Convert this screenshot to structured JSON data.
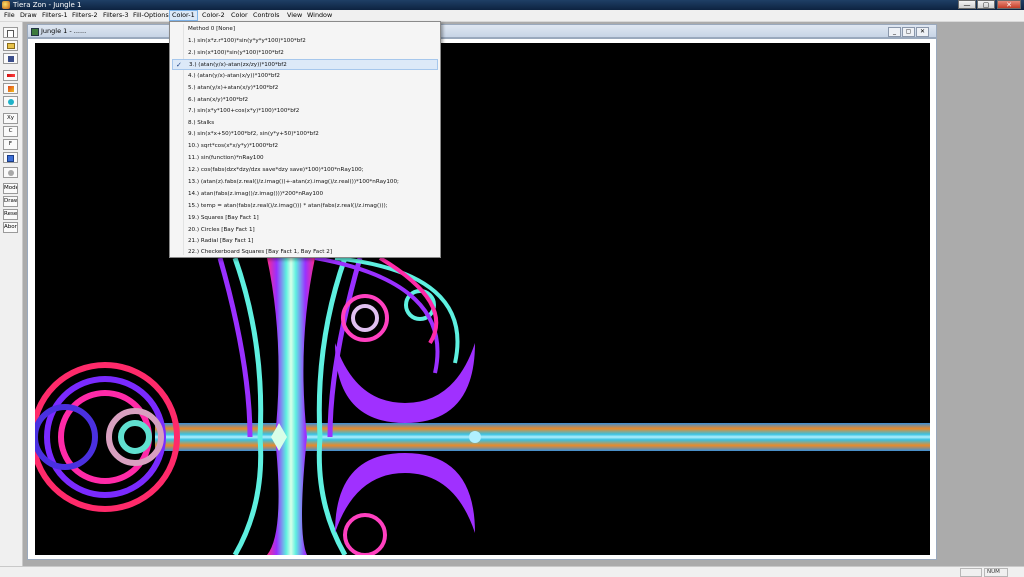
{
  "window": {
    "title": "Tiera Zon - Jungle 1",
    "min_label": "—",
    "max_label": "▢",
    "close_label": "✕"
  },
  "menubar": {
    "items": [
      "File",
      "Draw",
      "Filters-1",
      "Filters-2",
      "Filters-3",
      "Fill-Options",
      "Color-1",
      "Color-2",
      "Color",
      "Controls",
      "View",
      "Window"
    ],
    "active_index": 6
  },
  "toolbar": {
    "buttons": [
      {
        "icon": "new-document-icon",
        "label": ""
      },
      {
        "icon": "open-folder-icon",
        "label": ""
      },
      {
        "icon": "save-disk-icon",
        "label": ""
      },
      {
        "icon": "red-arrow-icon",
        "label": ""
      },
      {
        "icon": "fill-brush-icon",
        "label": ""
      },
      {
        "icon": "zoom-magnifier-icon",
        "label": ""
      },
      {
        "icon": "",
        "label": "Xy"
      },
      {
        "icon": "",
        "label": "C"
      },
      {
        "icon": "",
        "label": "F"
      },
      {
        "icon": "calendar-grid-icon",
        "label": ""
      },
      {
        "icon": "gray-circle-icon",
        "label": ""
      },
      {
        "icon": "",
        "label": "Mode"
      },
      {
        "icon": "",
        "label": "Draw"
      },
      {
        "icon": "",
        "label": "Reset"
      },
      {
        "icon": "",
        "label": "Abort"
      }
    ]
  },
  "child_window": {
    "title": "Jungle 1 - ......"
  },
  "color_menu": {
    "items": [
      "Method 0  [None]",
      "1.) sin(x*z.r*100)*sin(y*y*y*100)*100*bf2",
      "2.) sin(x*100)*sin(y*100)*100*bf2",
      "3.) (atan(y/x)-atan(zx/zy))*100*bf2",
      "4.) (atan(y/x)-atan(x/y))*100*bf2",
      "5.) atan(y/x)+atan(x/y)*100*bf2",
      "6.) atan(x/y)*100*bf2",
      "7.) sin(x*y*100+cos(x*y)*100)*100*bf2",
      "8.) Stalks",
      "9.) sin(x*x+50)*100*bf2, sin(y*y+50)*100*bf2",
      "10.) sqrt*cos(x*x/y*y)*1000*bf2",
      "11.) sin(function)*nRay100",
      "12.) cos(fabs(dzx*dzy/dzx save*dzy save)*100)*100*nRay100;",
      "13.) (atan(z).fabs(z.real()/z.imag())+-atan(z).imag()/z.real())*100*nRay100;",
      "14.) atan(fabs(z.imag()/z.imag()))*200*nRay100",
      "15.) temp = atan(fabs(z.real()/z.imag())) * atan(fabs(z.real()/z.imag()));",
      "19.) Squares [Bay Fact 1]",
      "20.) Circles [Bay Fact 1]",
      "21.) Radial [Bay Fact 1]",
      "22.) Checkerboard Squares [Bay Fact 1, Bay Fact 2]"
    ],
    "checked_index": 3,
    "check_mark": "✓"
  },
  "status": {
    "panels": [
      "",
      "NUM"
    ]
  },
  "colors": {
    "title_bar": "#0d2340",
    "menu_bg": "#f0f0f0",
    "canvas_bg": "#000000",
    "highlight": "#dce9f8"
  }
}
